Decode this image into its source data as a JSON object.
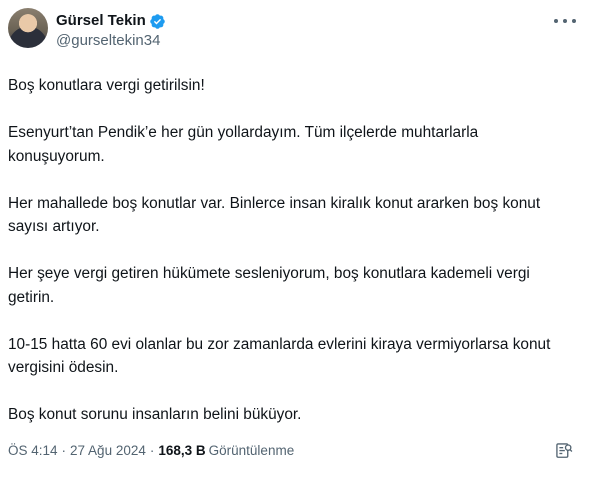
{
  "author": {
    "display_name": "Gürsel Tekin",
    "handle": "@gurseltekin34",
    "verified": true,
    "verified_color": "#1d9bf0"
  },
  "tweet": {
    "paragraphs": [
      "Boş konutlara vergi getirilsin!",
      "Esenyurt’tan Pendik’e her gün yollardayım. Tüm ilçelerde muhtarlarla konuşuyorum.",
      "Her mahallede boş konutlar var. Binlerce insan kiralık konut ararken boş konut sayısı artıyor.",
      "Her şeye vergi getiren hükümete sesleniyorum, boş konutlara kademeli vergi getirin.",
      "10-15 hatta 60 evi olanlar bu zor zamanlarda evlerini kiraya vermiyorlarsa konut vergisini ödesin.",
      "Boş konut sorunu insanların belini büküyor."
    ]
  },
  "meta": {
    "time": "ÖS 4:14",
    "separator": "·",
    "date": "27 Ağu 2024",
    "views_count": "168,3 B",
    "views_label": "Görüntülenme"
  },
  "icons": {
    "more": "more-horizontal-icon",
    "verified": "verified-badge-icon",
    "grok": "grok-explain-icon"
  }
}
